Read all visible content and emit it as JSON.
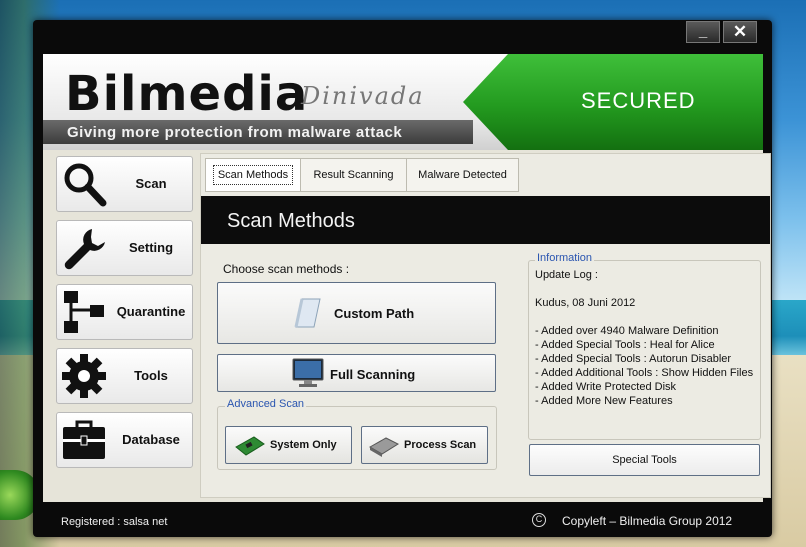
{
  "window": {
    "controls": {
      "minimize_label": "_",
      "close_label": "✕"
    }
  },
  "header": {
    "brand": "Bilmedia",
    "brand_script": "Dinivada",
    "tagline": "Giving more protection from malware attack",
    "status": "SECURED",
    "status_color": "#239a1f"
  },
  "sidebar": {
    "items": [
      {
        "label": "Scan",
        "icon": "magnifier-icon"
      },
      {
        "label": "Setting",
        "icon": "wrench-icon"
      },
      {
        "label": "Quarantine",
        "icon": "flowchart-icon"
      },
      {
        "label": "Tools",
        "icon": "gear-icon"
      },
      {
        "label": "Database",
        "icon": "toolbox-icon"
      }
    ]
  },
  "tabs": [
    {
      "label": "Scan Methods",
      "active": true
    },
    {
      "label": "Result Scanning",
      "active": false
    },
    {
      "label": "Malware Detected",
      "active": false
    }
  ],
  "main": {
    "section_title": "Scan Methods",
    "choose_label": "Choose scan methods   :",
    "custom_path_label": "Custom Path",
    "full_scanning_label": "Full Scanning",
    "advanced_scan": {
      "legend": "Advanced Scan",
      "system_only_label": "System Only",
      "process_scan_label": "Process Scan"
    },
    "information": {
      "legend": "Information",
      "lines": [
        "Update Log :",
        "",
        "Kudus, 08 Juni 2012",
        "",
        "- Added over 4940 Malware Definition",
        "- Added Special Tools : Heal for Alice",
        "- Added Special Tools : Autorun Disabler",
        "- Added Additional Tools : Show Hidden Files",
        "- Added Write Protected Disk",
        "- Added  More New Features"
      ]
    },
    "special_tools_label": "Special Tools"
  },
  "footer": {
    "registered": "Registered :  salsa net",
    "copyleft": "Copyleft  – Bilmedia Group 2012",
    "copyleft_symbol": "C"
  }
}
